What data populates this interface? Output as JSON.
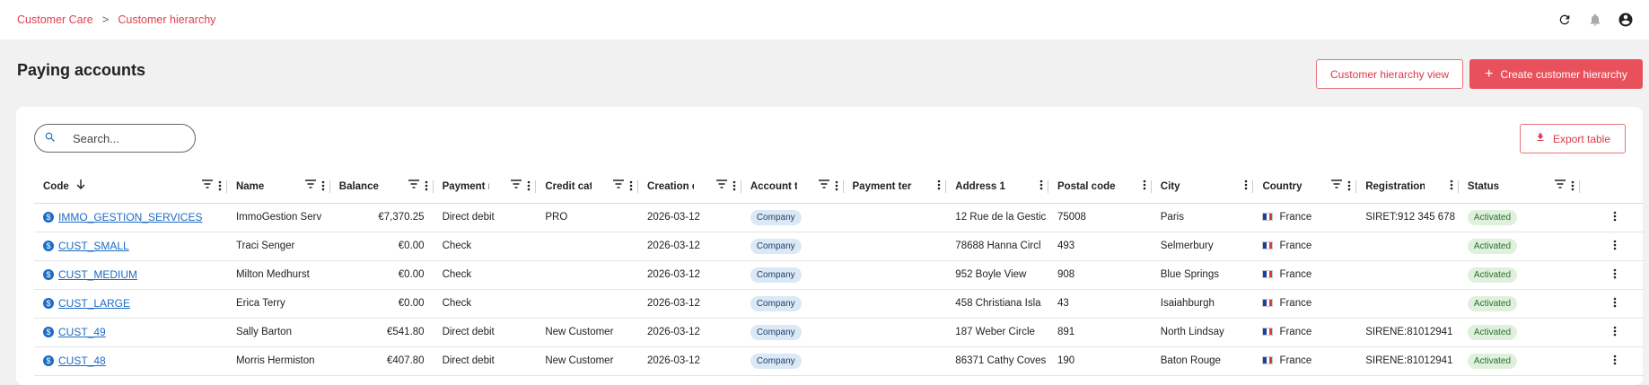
{
  "breadcrumb": {
    "parent": "Customer Care",
    "separator": ">",
    "current": "Customer hierarchy"
  },
  "page": {
    "title": "Paying accounts"
  },
  "actions": {
    "hierarchy_view": "Customer hierarchy view",
    "create": "Create customer hierarchy",
    "create_icon": "plus-icon",
    "export": "Export table",
    "export_icon": "download-icon"
  },
  "search": {
    "placeholder": "Search...",
    "value": ""
  },
  "colors": {
    "accent": "#e8505c",
    "link": "#1c6bc4",
    "chip_bg": "#dbe9f7",
    "status_bg": "#dff1dc"
  },
  "table": {
    "columns": [
      "Code",
      "Name",
      "Balance",
      "Payment me",
      "Credit categ",
      "Creation dat",
      "Account typ",
      "Payment term",
      "Address 1",
      "Postal code",
      "City",
      "Country",
      "Registration N°",
      "Status"
    ],
    "sorted_column": "Code",
    "sort_direction": "descending",
    "rows": [
      {
        "code": "IMMO_GESTION_SERVICES",
        "name": "ImmoGestion Serv",
        "balance": "€7,370.25",
        "payment": "Direct debit",
        "credit": "PRO",
        "created": "2026-03-12",
        "type": "Company",
        "term": "",
        "address": "12 Rue de la Gestic",
        "postal": "75008",
        "city": "Paris",
        "country": "France",
        "registration": "SIRET:912 345 678",
        "status": "Activated"
      },
      {
        "code": "CUST_SMALL",
        "name": "Traci Senger",
        "balance": "€0.00",
        "payment": "Check",
        "credit": "",
        "created": "2026-03-12",
        "type": "Company",
        "term": "",
        "address": "78688 Hanna Circl",
        "postal": "493",
        "city": "Selmerbury",
        "country": "France",
        "registration": "",
        "status": "Activated"
      },
      {
        "code": "CUST_MEDIUM",
        "name": "Milton Medhurst",
        "balance": "€0.00",
        "payment": "Check",
        "credit": "",
        "created": "2026-03-12",
        "type": "Company",
        "term": "",
        "address": "952 Boyle View",
        "postal": "908",
        "city": "Blue Springs",
        "country": "France",
        "registration": "",
        "status": "Activated"
      },
      {
        "code": "CUST_LARGE",
        "name": "Erica Terry",
        "balance": "€0.00",
        "payment": "Check",
        "credit": "",
        "created": "2026-03-12",
        "type": "Company",
        "term": "",
        "address": "458 Christiana Isla",
        "postal": "43",
        "city": "Isaiahburgh",
        "country": "France",
        "registration": "",
        "status": "Activated"
      },
      {
        "code": "CUST_49",
        "name": "Sally Barton",
        "balance": "€541.80",
        "payment": "Direct debit",
        "credit": "New Customer",
        "created": "2026-03-12",
        "type": "Company",
        "term": "",
        "address": "187 Weber Circle",
        "postal": "891",
        "city": "North Lindsay",
        "country": "France",
        "registration": "SIRENE:81012941",
        "status": "Activated"
      },
      {
        "code": "CUST_48",
        "name": "Morris Hermiston",
        "balance": "€407.80",
        "payment": "Direct debit",
        "credit": "New Customer",
        "created": "2026-03-12",
        "type": "Company",
        "term": "",
        "address": "86371 Cathy Coves",
        "postal": "190",
        "city": "Baton Rouge",
        "country": "France",
        "registration": "SIRENE:81012941",
        "status": "Activated"
      }
    ]
  }
}
